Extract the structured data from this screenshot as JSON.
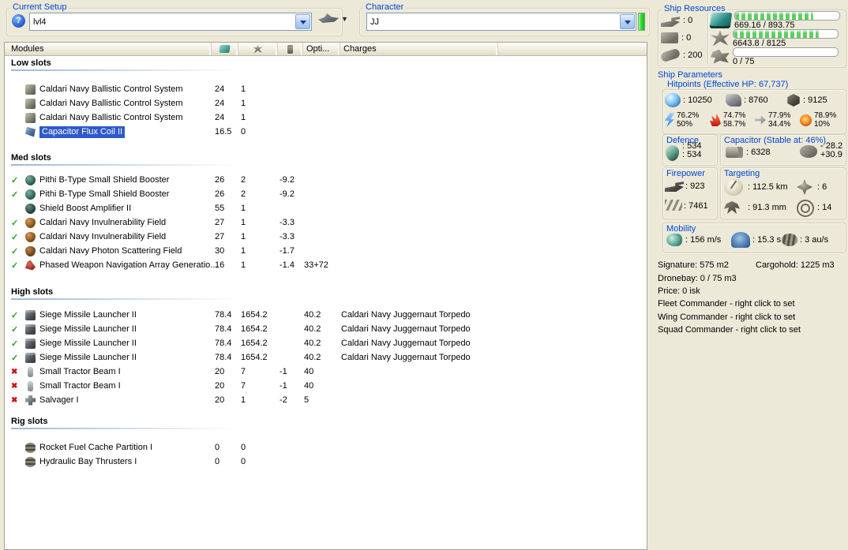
{
  "colors": {
    "title": "#0046d5",
    "sel": "#2f5acb",
    "check": "#2ca02c",
    "cross": "#c41414",
    "barfill": "#5ecf5e",
    "green": "#35e335"
  },
  "current_setup": {
    "label": "Current Setup",
    "value": "lvl4"
  },
  "character": {
    "label": "Character",
    "value": "JJ"
  },
  "ship_resources": {
    "title": "Ship Resources",
    "slots": [
      {
        "icon": "turret-hardpoints-icon",
        "value": "0"
      },
      {
        "icon": "launcher-hardpoints-icon",
        "value": "0"
      },
      {
        "icon": "calibration-icon",
        "value": "200"
      }
    ],
    "bars": [
      {
        "icon": "cpu-icon",
        "text": "669.16 / 893.75",
        "fill_pct": 74.9
      },
      {
        "icon": "powergrid-icon",
        "text": "6643.8 / 8125",
        "fill_pct": 81.8
      },
      {
        "icon": "dronebay-icon",
        "text": "0 / 75",
        "fill_pct": 0
      }
    ]
  },
  "ship_parameters": {
    "title": "Ship Parameters",
    "hitpoints": {
      "title": "Hitpoints (Effective HP: 67,737)",
      "pools": [
        {
          "icon": "shield-hp-icon",
          "value": "10250"
        },
        {
          "icon": "armor-hp-icon",
          "value": "8760"
        },
        {
          "icon": "structure-hp-icon",
          "value": "9125"
        }
      ],
      "resists": [
        {
          "icon": "em-resist-icon",
          "top": "76.2%",
          "bottom": "50%"
        },
        {
          "icon": "thermal-resist-icon",
          "top": "74.7%",
          "bottom": "58.7%"
        },
        {
          "icon": "kinetic-resist-icon",
          "top": "77.9%",
          "bottom": "34.4%"
        },
        {
          "icon": "explosive-resist-icon",
          "top": "78.9%",
          "bottom": "10%"
        }
      ]
    },
    "defence": {
      "title": "Defence",
      "line1": "534",
      "line2": "534"
    },
    "capacitor": {
      "title": "Capacitor (Stable at: 46%)",
      "amount": "6328",
      "delta_top": "- 28.2",
      "delta_bottom": "+30.9"
    },
    "firepower": {
      "title": "Firepower",
      "dps": "923",
      "volley": "7461"
    },
    "targeting": {
      "title": "Targeting",
      "range": "112.5 km",
      "max_targets": "6",
      "scan_res": "91.3 mm",
      "sensor_strength": "14"
    },
    "mobility": {
      "title": "Mobility",
      "speed": "156 m/s",
      "align": "15.3 s",
      "warp": "3 au/s"
    }
  },
  "summary": {
    "signature": "Signature: 575 m2",
    "cargohold": "Cargohold: 1225 m3",
    "dronebay": "Dronebay: 0 / 75 m3",
    "price": "Price: 0 isk",
    "fleet": "Fleet Commander - right click to set",
    "wing": "Wing Commander - right click to set",
    "squad": "Squad Commander - right click to set"
  },
  "modules": {
    "header": {
      "title": "Modules",
      "opti": "Opti...",
      "charges": "Charges"
    },
    "sections": [
      {
        "name": "Low slots",
        "rows": [
          {
            "state": "",
            "icon": "ballistic-control-icon",
            "name": "Caldari Navy Ballistic Control System",
            "cpu": "24",
            "pg": "1",
            "cap": "",
            "opti": "",
            "charge": "",
            "selected": false
          },
          {
            "state": "",
            "icon": "ballistic-control-icon",
            "name": "Caldari Navy Ballistic Control System",
            "cpu": "24",
            "pg": "1",
            "cap": "",
            "opti": "",
            "charge": "",
            "selected": false
          },
          {
            "state": "",
            "icon": "ballistic-control-icon",
            "name": "Caldari Navy Ballistic Control System",
            "cpu": "24",
            "pg": "1",
            "cap": "",
            "opti": "",
            "charge": "",
            "selected": false
          },
          {
            "state": "",
            "icon": "capacitor-flux-icon",
            "name": "Capacitor Flux Coil II",
            "cpu": "16.5",
            "pg": "0",
            "cap": "",
            "opti": "",
            "charge": "",
            "selected": true
          }
        ]
      },
      {
        "name": "Med slots",
        "rows": [
          {
            "state": "check",
            "icon": "shield-booster-icon",
            "name": "Pithi B-Type Small Shield Booster",
            "cpu": "26",
            "pg": "2",
            "cap": "-9.2",
            "opti": "",
            "charge": "",
            "selected": false
          },
          {
            "state": "check",
            "icon": "shield-booster-icon",
            "name": "Pithi B-Type Small Shield Booster",
            "cpu": "26",
            "pg": "2",
            "cap": "-9.2",
            "opti": "",
            "charge": "",
            "selected": false
          },
          {
            "state": "",
            "icon": "shield-amplifier-icon",
            "name": "Shield Boost Amplifier II",
            "cpu": "55",
            "pg": "1",
            "cap": "",
            "opti": "",
            "charge": "",
            "selected": false
          },
          {
            "state": "check",
            "icon": "invulnerability-icon",
            "name": "Caldari Navy Invulnerability Field",
            "cpu": "27",
            "pg": "1",
            "cap": "-3.3",
            "opti": "",
            "charge": "",
            "selected": false
          },
          {
            "state": "check",
            "icon": "invulnerability-icon",
            "name": "Caldari Navy Invulnerability Field",
            "cpu": "27",
            "pg": "1",
            "cap": "-3.3",
            "opti": "",
            "charge": "",
            "selected": false
          },
          {
            "state": "check",
            "icon": "photon-scattering-icon",
            "name": "Caldari Navy Photon Scattering Field",
            "cpu": "30",
            "pg": "1",
            "cap": "-1.7",
            "opti": "",
            "charge": "",
            "selected": false
          },
          {
            "state": "check",
            "icon": "phased-weapon-icon",
            "name": "Phased Weapon Navigation Array Generatio...",
            "cpu": "16",
            "pg": "1",
            "cap": "-1.4",
            "opti": "33+72",
            "charge": "",
            "selected": false
          }
        ]
      },
      {
        "name": "High slots",
        "rows": [
          {
            "state": "check",
            "icon": "siege-launcher-icon",
            "name": "Siege Missile Launcher II",
            "cpu": "78.4",
            "pg": "1654.2",
            "cap": "",
            "opti": "40.2",
            "charge": "Caldari Navy Juggernaut Torpedo",
            "selected": false
          },
          {
            "state": "check",
            "icon": "siege-launcher-icon",
            "name": "Siege Missile Launcher II",
            "cpu": "78.4",
            "pg": "1654.2",
            "cap": "",
            "opti": "40.2",
            "charge": "Caldari Navy Juggernaut Torpedo",
            "selected": false
          },
          {
            "state": "check",
            "icon": "siege-launcher-icon",
            "name": "Siege Missile Launcher II",
            "cpu": "78.4",
            "pg": "1654.2",
            "cap": "",
            "opti": "40.2",
            "charge": "Caldari Navy Juggernaut Torpedo",
            "selected": false
          },
          {
            "state": "check",
            "icon": "siege-launcher-icon",
            "name": "Siege Missile Launcher II",
            "cpu": "78.4",
            "pg": "1654.2",
            "cap": "",
            "opti": "40.2",
            "charge": "Caldari Navy Juggernaut Torpedo",
            "selected": false
          },
          {
            "state": "cross",
            "icon": "tractor-beam-icon",
            "name": "Small Tractor Beam I",
            "cpu": "20",
            "pg": "7",
            "cap": "-1",
            "opti": "40",
            "charge": "",
            "selected": false
          },
          {
            "state": "cross",
            "icon": "tractor-beam-icon",
            "name": "Small Tractor Beam I",
            "cpu": "20",
            "pg": "7",
            "cap": "-1",
            "opti": "40",
            "charge": "",
            "selected": false
          },
          {
            "state": "cross",
            "icon": "salvager-icon",
            "name": "Salvager I",
            "cpu": "20",
            "pg": "1",
            "cap": "-2",
            "opti": "5",
            "charge": "",
            "selected": false
          }
        ]
      },
      {
        "name": "Rig slots",
        "rows": [
          {
            "state": "",
            "icon": "rig-icon",
            "name": "Rocket Fuel Cache Partition I",
            "cpu": "0",
            "pg": "0",
            "cap": "",
            "opti": "",
            "charge": "",
            "selected": false
          },
          {
            "state": "",
            "icon": "rig-icon",
            "name": "Hydraulic Bay Thrusters I",
            "cpu": "0",
            "pg": "0",
            "cap": "",
            "opti": "",
            "charge": "",
            "selected": false
          }
        ]
      }
    ]
  }
}
